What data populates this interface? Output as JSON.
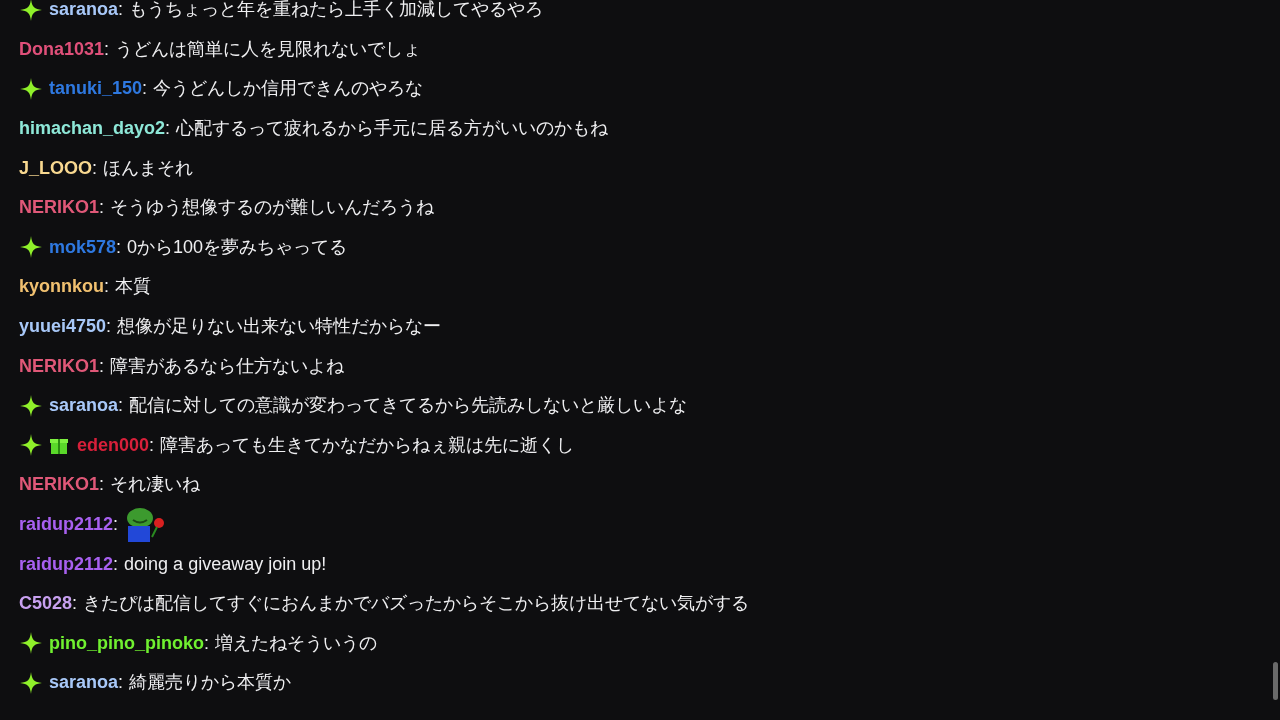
{
  "messages": [
    {
      "badges": [
        {
          "kind": "sparkle"
        }
      ],
      "user": "saranoa",
      "separator": ":",
      "color": "#a8c8f8",
      "kind": "text",
      "text": "もうちょっと年を重ねたら上手く加減してやるやろ"
    },
    {
      "user": "Dona1031",
      "separator": ":",
      "color": "#e0507a",
      "kind": "text",
      "text": "うどんは簡単に人を見限れないでしょ"
    },
    {
      "badges": [
        {
          "kind": "sparkle"
        }
      ],
      "user": "tanuki_150",
      "separator": ":",
      "color": "#2e78e0",
      "kind": "text",
      "text": "今うどんしか信用できんのやろな"
    },
    {
      "user": "himachan_dayo2",
      "separator": ":",
      "color": "#8ee8d8",
      "kind": "text",
      "text": "心配するって疲れるから手元に居る方がいいのかもね"
    },
    {
      "user": "J_LOOO",
      "separator": ":",
      "color": "#f8d890",
      "kind": "text",
      "text": "ほんまそれ"
    },
    {
      "user": "NERIKO1",
      "separator": ":",
      "color": "#e05878",
      "kind": "text",
      "text": "そうゆう想像するのが難しいんだろうね"
    },
    {
      "badges": [
        {
          "kind": "sparkle"
        }
      ],
      "user": "mok578",
      "separator": ":",
      "color": "#2e78e0",
      "kind": "text",
      "text": "0から100を夢みちゃってる"
    },
    {
      "user": "kyonnkou",
      "separator": ":",
      "color": "#f0c070",
      "kind": "text",
      "text": "本質"
    },
    {
      "user": "yuuei4750",
      "separator": ":",
      "color": "#a8c8f8",
      "kind": "text",
      "text": "想像が足りない出来ない特性だからなー"
    },
    {
      "user": "NERIKO1",
      "separator": ":",
      "color": "#e05878",
      "kind": "text",
      "text": "障害があるなら仕方ないよね"
    },
    {
      "badges": [
        {
          "kind": "sparkle"
        }
      ],
      "user": "saranoa",
      "separator": ":",
      "color": "#a8c8f8",
      "kind": "text",
      "text": "配信に対しての意識が変わってきてるから先読みしないと厳しいよな"
    },
    {
      "badges": [
        {
          "kind": "sparkle"
        },
        {
          "kind": "gift"
        }
      ],
      "user": "eden000",
      "separator": ":",
      "color": "#d8203a",
      "kind": "text",
      "text": "障害あっても生きてかなだからねぇ親は先に逝くし"
    },
    {
      "user": "NERIKO1",
      "separator": ":",
      "color": "#e05878",
      "kind": "text",
      "text": "それ凄いね"
    },
    {
      "user": "raidup2112",
      "separator": ":",
      "color": "#a860f0",
      "kind": "emote"
    },
    {
      "user": "raidup2112",
      "separator": ":",
      "color": "#a860f0",
      "kind": "text",
      "text": "doing a giveaway join up!"
    },
    {
      "user": "C5028",
      "separator": ":",
      "color": "#c8a0f0",
      "kind": "text",
      "text": "きたぴは配信してすぐにおんまかでバズったからそこから抜け出せてない気がする"
    },
    {
      "badges": [
        {
          "kind": "sparkle"
        }
      ],
      "user": "pino_pino_pinoko",
      "separator": ":",
      "color": "#70f030",
      "kind": "text",
      "text": "増えたねそういうの"
    },
    {
      "badges": [
        {
          "kind": "sparkle"
        }
      ],
      "user": "saranoa",
      "separator": ":",
      "color": "#a8c8f8",
      "kind": "text",
      "text": "綺麗売りから本質か"
    }
  ]
}
